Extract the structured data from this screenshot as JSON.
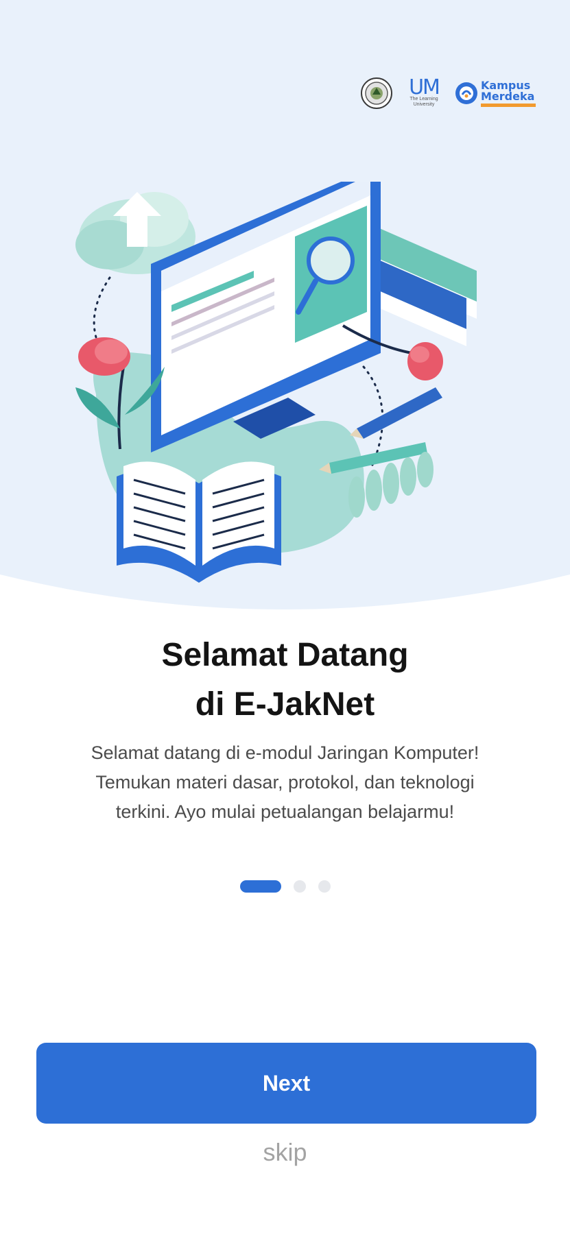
{
  "logos": {
    "um_mark": "UM",
    "um_sub_line1": "The Learning",
    "um_sub_line2": "University",
    "km_line1": "Kampus",
    "km_line2": "Merdeka"
  },
  "onboarding": {
    "title_line1": "Selamat Datang",
    "title_line2": "di E-JakNet",
    "desc_line1": "Selamat datang di e-modul Jaringan Komputer!",
    "desc_line2": "Temukan materi dasar, protokol, dan teknologi",
    "desc_line3": "terkini. Ayo mulai petualangan belajarmu!",
    "page_count": 3,
    "active_page": 1
  },
  "actions": {
    "next_label": "Next",
    "skip_label": "skip"
  },
  "colors": {
    "primary": "#2d6fd6",
    "hero_bg": "#e9f1fb",
    "teal": "#5cc3b5",
    "accent_red": "#e8596a"
  }
}
